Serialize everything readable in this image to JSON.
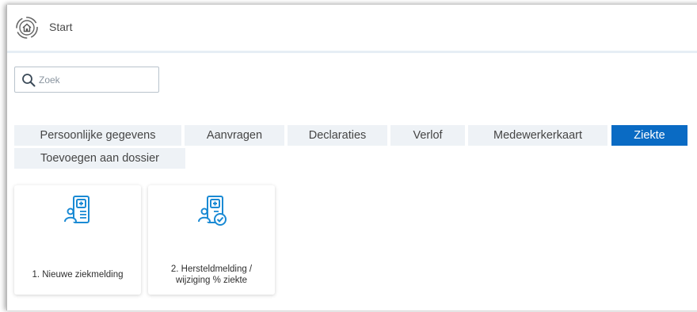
{
  "header": {
    "title": "Start",
    "icon": "home-icon"
  },
  "search": {
    "placeholder": "Zoek",
    "value": ""
  },
  "tabs": [
    {
      "label": "Persoonlijke gegevens",
      "active": false
    },
    {
      "label": "Aanvragen",
      "active": false
    },
    {
      "label": "Declaraties",
      "active": false
    },
    {
      "label": "Verlof",
      "active": false
    },
    {
      "label": "Medewerkerkaart",
      "active": false
    },
    {
      "label": "Ziekte",
      "active": true
    },
    {
      "label": "Toevoegen aan dossier",
      "active": false
    }
  ],
  "cards": [
    {
      "label_line1": "1. Nieuwe ziekmelding",
      "label_line2": "",
      "icon": "sick-report-icon"
    },
    {
      "label_line1": "2. Hersteldmelding /",
      "label_line2": "wijziging % ziekte",
      "icon": "recovery-report-icon"
    }
  ],
  "colors": {
    "accent": "#0a6bc4",
    "tab_bg": "#eef2f6",
    "icon_blue": "#1a8ad4"
  }
}
